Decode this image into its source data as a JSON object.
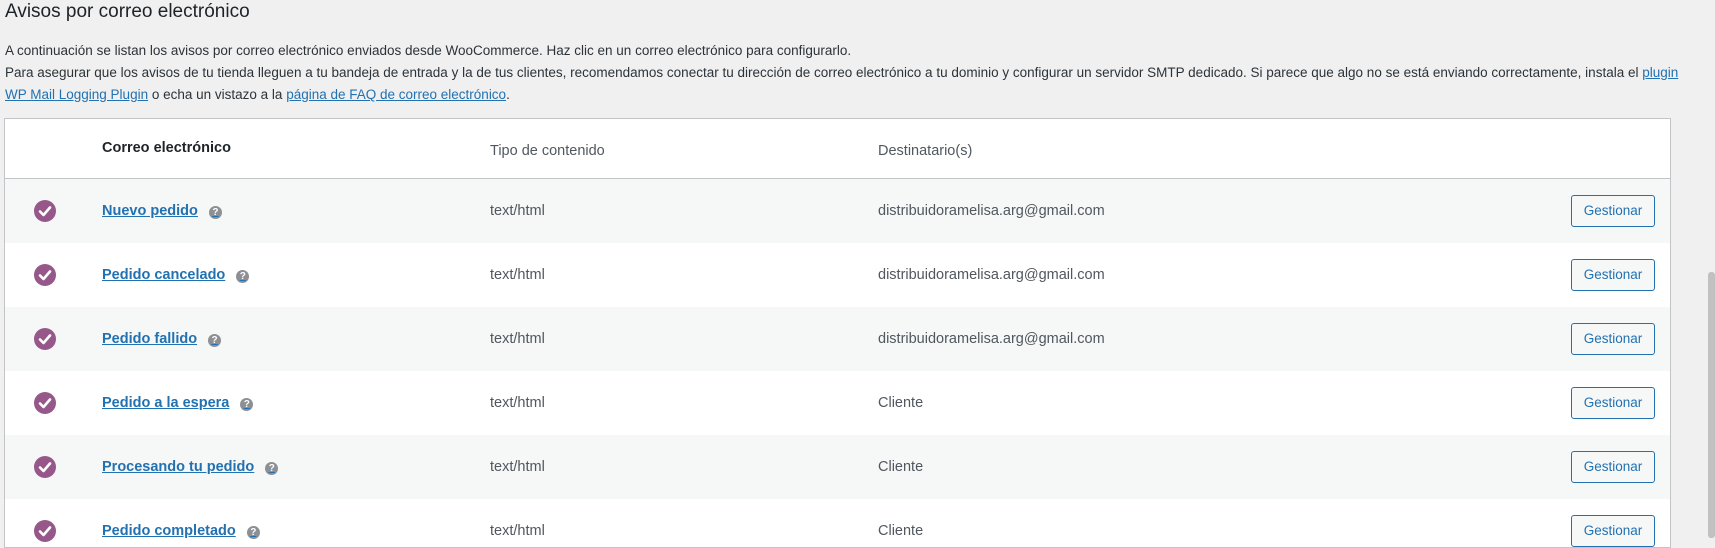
{
  "header": {
    "title": "Avisos por correo electrónico"
  },
  "intro": {
    "line1": "A continuación se listan los avisos por correo electrónico enviados desde WooCommerce. Haz clic en un correo electrónico para configurarlo.",
    "line2_before": "Para asegurar que los avisos de tu tienda lleguen a tu bandeja de entrada y la de tus clientes, recomendamos conectar tu dirección de correo electrónico a tu dominio y configurar un servidor SMTP dedicado. Si parece que algo no se está enviando correctamente, instala el ",
    "link_plugin": "plugin WP Mail Logging Plugin",
    "line2_middle": " o echa un vistazo a la ",
    "link_faq": "página de FAQ de correo electrónico",
    "line2_after": "."
  },
  "table": {
    "columns": {
      "email": "Correo electrónico",
      "content_type": "Tipo de contenido",
      "recipients": "Destinatario(s)"
    },
    "rows": [
      {
        "name": "Nuevo pedido",
        "content_type": "text/html",
        "recipient": "distribuidoramelisa.arg@gmail.com",
        "action": "Gestionar"
      },
      {
        "name": "Pedido cancelado",
        "content_type": "text/html",
        "recipient": "distribuidoramelisa.arg@gmail.com",
        "action": "Gestionar"
      },
      {
        "name": "Pedido fallido",
        "content_type": "text/html",
        "recipient": "distribuidoramelisa.arg@gmail.com",
        "action": "Gestionar"
      },
      {
        "name": "Pedido a la espera",
        "content_type": "text/html",
        "recipient": "Cliente",
        "action": "Gestionar"
      },
      {
        "name": "Procesando tu pedido",
        "content_type": "text/html",
        "recipient": "Cliente",
        "action": "Gestionar"
      },
      {
        "name": "Pedido completado",
        "content_type": "text/html",
        "recipient": "Cliente",
        "action": "Gestionar"
      }
    ],
    "help_glyph": "?"
  },
  "colors": {
    "accent": "#2271b1",
    "check": "#96588a"
  }
}
